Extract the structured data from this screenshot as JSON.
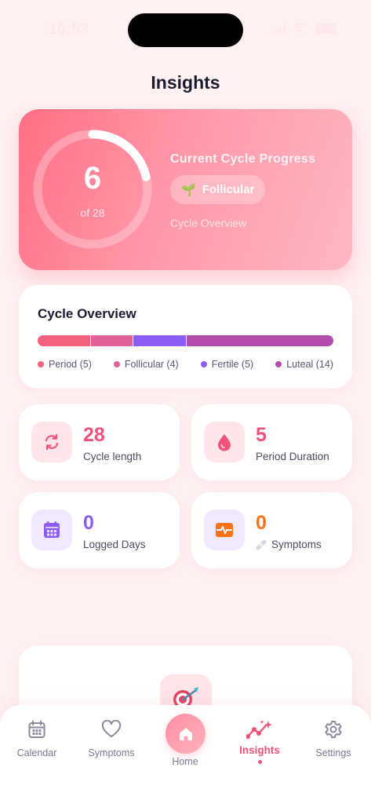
{
  "status_bar": {
    "time": "10:53"
  },
  "page": {
    "title": "Insights"
  },
  "hero": {
    "day": "6",
    "of_days": "of 28",
    "progress_fraction": 0.214,
    "title": "Current Cycle Progress",
    "phase_label": "Follicular",
    "phase_emoji": "🌱",
    "link": "Cycle Overview"
  },
  "overview": {
    "title": "Cycle Overview",
    "segments": [
      {
        "label": "Period (5)",
        "days": 5,
        "color": "#f2607c"
      },
      {
        "label": "Follicular (4)",
        "days": 4,
        "color": "#e0609a"
      },
      {
        "label": "Fertile (5)",
        "days": 5,
        "color": "#8b5cf6"
      },
      {
        "label": "Luteal (14)",
        "days": 14,
        "color": "#b44aad"
      }
    ]
  },
  "stats": {
    "cycle_length": {
      "value": "28",
      "label": "Cycle length",
      "icon": "refresh-icon",
      "color": "#f0527a"
    },
    "period_duration": {
      "value": "5",
      "label": "Period Duration",
      "icon": "drop-icon",
      "color": "#f0527a"
    },
    "logged_days": {
      "value": "0",
      "label": "Logged Days",
      "icon": "calendar-icon",
      "color": "#8b5cf6"
    },
    "symptoms": {
      "value": "0",
      "label": "Symptoms",
      "icon": "pulse-icon",
      "color": "#f97316"
    }
  },
  "nav": {
    "calendar": "Calendar",
    "symptoms": "Symptoms",
    "home": "Home",
    "insights": "Insights",
    "settings": "Settings",
    "active": "insights"
  }
}
